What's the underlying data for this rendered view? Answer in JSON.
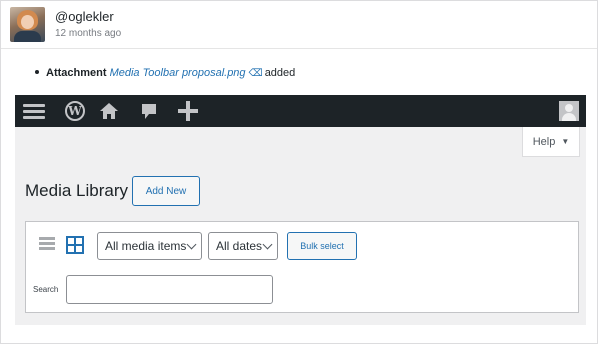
{
  "comment": {
    "username": "@oglekler",
    "timestamp": "12 months ago",
    "avatar_icon": "user-photo-avatar"
  },
  "change": {
    "field_label": "Attachment",
    "file_name": "Media Toolbar proposal.png",
    "action": "added",
    "attachment_icon": "pin-icon"
  },
  "screenshot": {
    "admin_bar": {
      "icons": [
        "menu-icon",
        "wordpress-logo-icon",
        "home-icon",
        "comment-icon",
        "plus-icon",
        "account-avatar-icon"
      ]
    },
    "help_tab": {
      "label": "Help",
      "caret": "▼"
    },
    "page_title": "Media Library",
    "add_new_label": "Add New",
    "toolbar": {
      "view_icons": [
        "list-view-icon",
        "grid-view-icon"
      ],
      "active_view": "grid",
      "media_filter": "All media items",
      "date_filter": "All dates",
      "bulk_select_label": "Bulk select",
      "search_label": "Search",
      "search_value": ""
    }
  },
  "colors": {
    "admin_bar_bg": "#1d2327",
    "accent": "#2271b1",
    "screen_bg": "#f0f0f1"
  }
}
